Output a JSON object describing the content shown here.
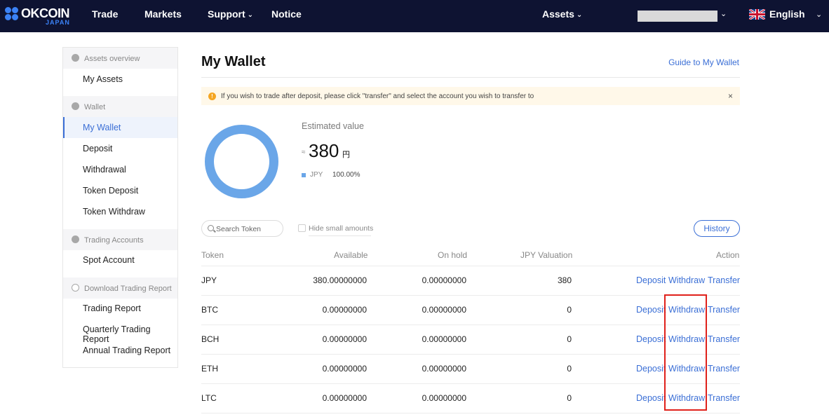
{
  "brand": {
    "name": "OKCOIN",
    "sub": "JAPAN"
  },
  "nav": {
    "trade": "Trade",
    "markets": "Markets",
    "support": "Support",
    "notice": "Notice",
    "assets": "Assets",
    "language": "English"
  },
  "sidebar": {
    "assets_overview": {
      "header": "Assets overview",
      "items": [
        "My Assets"
      ]
    },
    "wallet": {
      "header": "Wallet",
      "items": [
        "My Wallet",
        "Deposit",
        "Withdrawal",
        "Token Deposit",
        "Token Withdraw"
      ]
    },
    "trading_accounts": {
      "header": "Trading Accounts",
      "items": [
        "Spot Account"
      ]
    },
    "download_report": {
      "header": "Download Trading Report",
      "items": [
        "Trading Report",
        "Quarterly Trading Report",
        "Annual Trading Report"
      ]
    },
    "active": "My Wallet"
  },
  "main": {
    "title": "My Wallet",
    "guide": "Guide to My Wallet",
    "notice": "If you wish to trade after deposit, please click \"transfer\" and select the account you wish to transfer to",
    "notice_close": "×",
    "estimated_label": "Estimated value",
    "approx": "≈",
    "estimated_value": "380",
    "estimated_unit": "円",
    "legend": {
      "name": "JPY",
      "percent": "100.00%",
      "fraction": 1.0,
      "color": "#6aa6e8"
    },
    "search_placeholder": "Search Token",
    "hide_small": "Hide small amounts",
    "history": "History"
  },
  "table": {
    "headers": {
      "token": "Token",
      "available": "Available",
      "on_hold": "On hold",
      "valuation": "JPY Valuation",
      "action": "Action"
    },
    "rows": [
      {
        "token": "JPY",
        "available": "380.00000000",
        "on_hold": "0.00000000",
        "valuation": "380",
        "deposit": "Deposit",
        "withdraw": "Withdraw",
        "transfer": "Transfer"
      },
      {
        "token": "BTC",
        "available": "0.00000000",
        "on_hold": "0.00000000",
        "valuation": "0",
        "deposit": "Deposit",
        "withdraw": "Withdraw",
        "transfer": "Transfer"
      },
      {
        "token": "BCH",
        "available": "0.00000000",
        "on_hold": "0.00000000",
        "valuation": "0",
        "deposit": "Deposit",
        "withdraw": "Withdraw",
        "transfer": "Transfer"
      },
      {
        "token": "ETH",
        "available": "0.00000000",
        "on_hold": "0.00000000",
        "valuation": "0",
        "deposit": "Deposit",
        "withdraw": "Withdraw",
        "transfer": "Transfer"
      },
      {
        "token": "LTC",
        "available": "0.00000000",
        "on_hold": "0.00000000",
        "valuation": "0",
        "deposit": "Deposit",
        "withdraw": "Withdraw",
        "transfer": "Transfer"
      }
    ]
  },
  "colors": {
    "nav_bg": "#0e1332",
    "accent": "#3b6fd6",
    "highlight": "#e0211b"
  }
}
